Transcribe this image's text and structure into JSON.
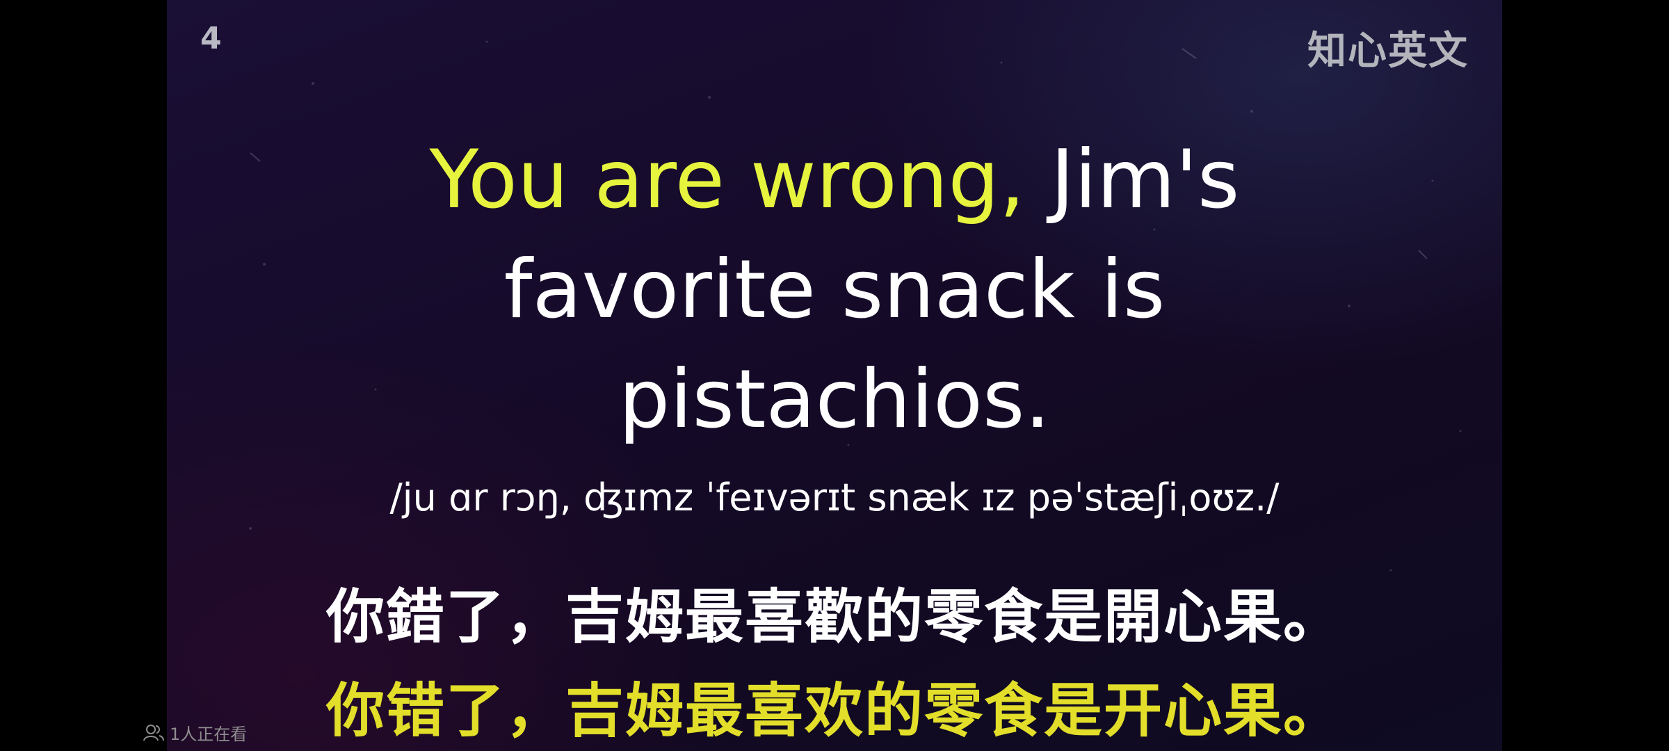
{
  "slide": {
    "number": "4",
    "watermark": "知心英文"
  },
  "sentence": {
    "highlight": "You are wrong,",
    "rest_line1": " Jim's",
    "line2": "favorite snack is",
    "line3": "pistachios."
  },
  "ipa": "/ju ɑr rɔŋ, ʤɪmz ˈfeɪvərɪt snæk ɪz pəˈstæʃiˌoʊz./",
  "translation": {
    "traditional": "你錯了，吉姆最喜歡的零食是開心果。",
    "simplified": "你错了，吉姆最喜欢的零食是开心果。"
  },
  "viewers": {
    "icon": "people-icon",
    "text": "1人正在看"
  },
  "colors": {
    "highlight_english": "#e6f43e",
    "highlight_chinese": "#e2de2a",
    "main_text": "#ffffff",
    "background_dark": "#160b2b"
  }
}
